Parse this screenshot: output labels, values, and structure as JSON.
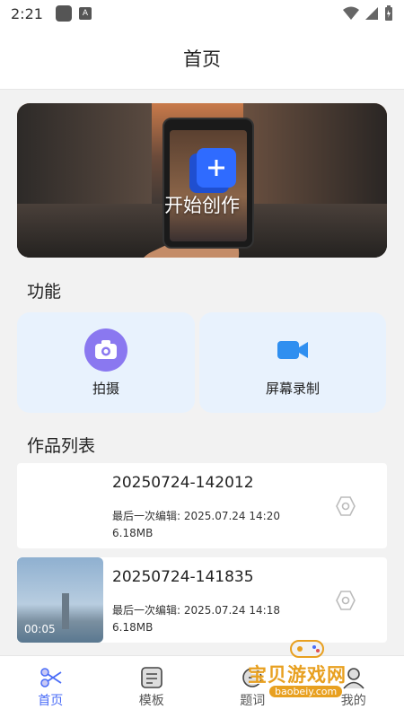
{
  "status_bar": {
    "time": "2:21",
    "a_icon_glyph": "A"
  },
  "app_bar": {
    "title": "首页"
  },
  "hero": {
    "label": "开始创作",
    "icon": "plus-icon"
  },
  "features": {
    "section_title": "功能",
    "items": [
      {
        "label": "拍摄",
        "icon": "camera-icon"
      },
      {
        "label": "屏幕录制",
        "icon": "video-camera-icon"
      }
    ]
  },
  "works": {
    "section_title": "作品列表",
    "items": [
      {
        "name": "20250724-142012",
        "edited": "最后一次编辑: 2025.07.24 14:20",
        "size": "6.18MB",
        "duration": ""
      },
      {
        "name": "20250724-141835",
        "edited": "最后一次编辑: 2025.07.24 14:18",
        "size": "6.18MB",
        "duration": "00:05"
      }
    ]
  },
  "bottom_nav": {
    "items": [
      {
        "label": "首页",
        "icon": "scissors-icon",
        "active": true
      },
      {
        "label": "模板",
        "icon": "template-icon",
        "active": false
      },
      {
        "label": "题词",
        "icon": "teleprompter-icon",
        "active": false
      },
      {
        "label": "我的",
        "icon": "profile-icon",
        "active": false
      }
    ]
  },
  "watermark": {
    "text": "宝贝游戏网",
    "url": "baobeiy.com"
  },
  "colors": {
    "accent": "#4a6cf7",
    "feature_bg": "#e8f2fd",
    "camera_icon_bg": "#8a78f0",
    "record_icon": "#2f8ff0",
    "watermark": "#e8a020"
  }
}
